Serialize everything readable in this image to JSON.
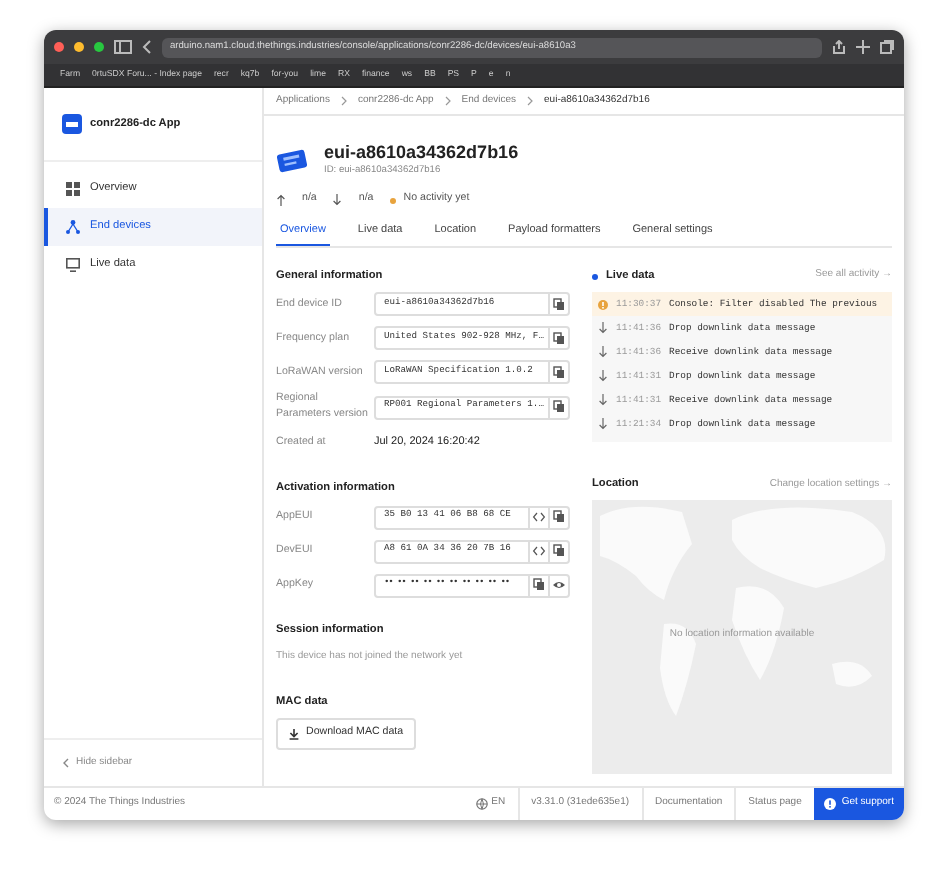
{
  "browser": {
    "url": "arduino.nam1.cloud.thethings.industries/console/applications/conr2286-dc/devices/eui-a8610a3",
    "bookmarks": [
      "Farm",
      "0rtuSDX Foru... - Index page",
      "recr",
      "kq7b",
      "for-you",
      "lime",
      "RX",
      "finance",
      "ws",
      "BB",
      "PS",
      "P",
      "e",
      "n"
    ]
  },
  "sidebar": {
    "app_name": "conr2286-dc App",
    "items": [
      {
        "label": "Overview",
        "kind": "grid",
        "selected": false
      },
      {
        "label": "End devices",
        "kind": "nodes",
        "selected": true
      },
      {
        "label": "Live data",
        "kind": "monitor",
        "selected": false
      }
    ],
    "hide_label": "Hide sidebar"
  },
  "breadcrumbs": [
    "Applications",
    "conr2286-dc App",
    "End devices",
    "eui-a8610a34362d7b16"
  ],
  "device": {
    "title": "eui-a8610a34362d7b16",
    "id_line": "ID: eui-a8610a34362d7b16",
    "uplink": "n/a",
    "downlink": "n/a",
    "activity": "No activity yet"
  },
  "tabs": [
    {
      "label": "Overview",
      "selected": true
    },
    {
      "label": "Live data",
      "selected": false
    },
    {
      "label": "Location",
      "selected": false
    },
    {
      "label": "Payload formatters",
      "selected": false
    },
    {
      "label": "General settings",
      "selected": false
    }
  ],
  "general": {
    "heading": "General information",
    "fields": [
      {
        "label": "End device ID",
        "value": "eui-a8610a34362d7b16",
        "kind": "copy"
      },
      {
        "label": "Frequency plan",
        "value": "United States 902-928 MHz, F…",
        "kind": "copy"
      },
      {
        "label": "LoRaWAN version",
        "value": "LoRaWAN Specification 1.0.2",
        "kind": "copy"
      },
      {
        "label": "Regional Parameters version",
        "value": "RP001 Regional Parameters 1.…",
        "kind": "copy"
      },
      {
        "label": "Created at",
        "value": "Jul 20, 2024 16:20:42",
        "kind": "text"
      }
    ]
  },
  "activation": {
    "heading": "Activation information",
    "fields": [
      {
        "label": "AppEUI",
        "value": "35 B0 13 41 06 B8 68 CE",
        "kind": "hex"
      },
      {
        "label": "DevEUI",
        "value": "A8 61 0A 34 36 20 7B 16",
        "kind": "hex"
      },
      {
        "label": "AppKey",
        "value": "•• •• •• •• •• •• •• •• •• ••",
        "kind": "secret"
      }
    ]
  },
  "session": {
    "heading": "Session information",
    "text": "This device has not joined the network yet"
  },
  "mac": {
    "heading": "MAC data",
    "button": "Download MAC data"
  },
  "live_data": {
    "heading": "Live data",
    "link": "See all activity →",
    "events": [
      {
        "kind": "warning",
        "time": "11:30:37",
        "message": "Console: Filter disabled  The previous"
      },
      {
        "kind": "downlink",
        "time": "11:41:36",
        "message": "Drop downlink data message"
      },
      {
        "kind": "downlink",
        "time": "11:41:36",
        "message": "Receive downlink data message"
      },
      {
        "kind": "downlink",
        "time": "11:41:31",
        "message": "Drop downlink data message"
      },
      {
        "kind": "downlink",
        "time": "11:41:31",
        "message": "Receive downlink data message"
      },
      {
        "kind": "downlink",
        "time": "11:21:34",
        "message": "Drop downlink data message"
      }
    ]
  },
  "location": {
    "heading": "Location",
    "link": "Change location settings →",
    "map_text": "No location information available"
  },
  "footer": {
    "copyright": "© 2024 The Things Industries",
    "language": "EN",
    "version": "v3.31.0 (31ede635e1)",
    "links": [
      "Documentation",
      "Status page"
    ],
    "support": "Get support"
  }
}
